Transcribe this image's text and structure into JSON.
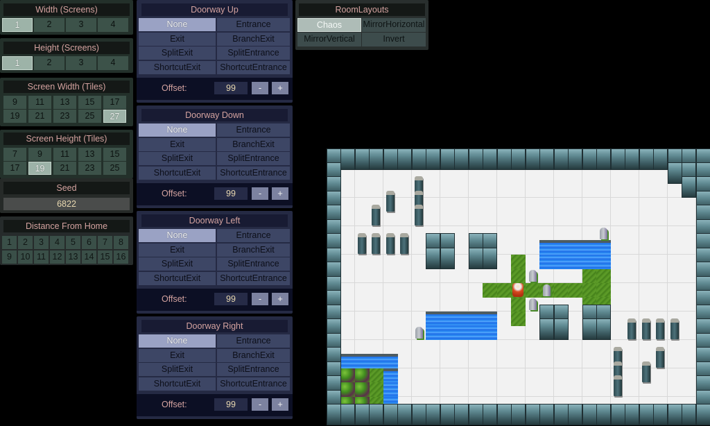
{
  "width_screens": {
    "title": "Width (Screens)",
    "options": [
      "1",
      "2",
      "3",
      "4"
    ],
    "selected": "1"
  },
  "height_screens": {
    "title": "Height (Screens)",
    "options": [
      "1",
      "2",
      "3",
      "4"
    ],
    "selected": "1"
  },
  "screen_width_tiles": {
    "title": "Screen Width (Tiles)",
    "options": [
      "9",
      "11",
      "13",
      "15",
      "17",
      "19",
      "21",
      "23",
      "25",
      "27"
    ],
    "selected": "27"
  },
  "screen_height_tiles": {
    "title": "Screen Height (Tiles)",
    "options": [
      "7",
      "9",
      "11",
      "13",
      "15",
      "17",
      "19",
      "21",
      "23",
      "25"
    ],
    "selected": "19"
  },
  "seed": {
    "title": "Seed",
    "value": "6822"
  },
  "distance_from_home": {
    "title": "Distance From Home",
    "options": [
      "1",
      "2",
      "3",
      "4",
      "5",
      "6",
      "7",
      "8",
      "9",
      "10",
      "11",
      "12",
      "13",
      "14",
      "15",
      "16"
    ],
    "selected": "1"
  },
  "doorway_options": [
    "None",
    "Entrance",
    "Exit",
    "BranchExit",
    "SplitExit",
    "SplitEntrance",
    "ShortcutExit",
    "ShortcutEntrance"
  ],
  "doorways": [
    {
      "title": "Doorway Up",
      "selected": "None",
      "offset_label": "Offset:",
      "offset": "99",
      "minus": "-",
      "plus": "+"
    },
    {
      "title": "Doorway Down",
      "selected": "None",
      "offset_label": "Offset:",
      "offset": "99",
      "minus": "-",
      "plus": "+"
    },
    {
      "title": "Doorway Left",
      "selected": "None",
      "offset_label": "Offset:",
      "offset": "99",
      "minus": "-",
      "plus": "+"
    },
    {
      "title": "Doorway Right",
      "selected": "None",
      "offset_label": "Offset:",
      "offset": "99",
      "minus": "-",
      "plus": "+"
    }
  ],
  "room_layouts": {
    "title": "RoomLayouts",
    "options": [
      "Chaos",
      "MirrorHorizontal",
      "MirrorVertical",
      "Invert"
    ],
    "selected": "Chaos"
  },
  "map": {
    "cols": 27,
    "rows": 19,
    "wall_extra": [
      [
        24,
        1
      ],
      [
        25,
        1
      ],
      [
        25,
        2
      ]
    ],
    "wall_blocks": [
      [
        7,
        6,
        2,
        2
      ],
      [
        10,
        6,
        2,
        2
      ],
      [
        15,
        11,
        2,
        2
      ],
      [
        18,
        11,
        2,
        2
      ]
    ],
    "water": [
      [
        15,
        6,
        5,
        2
      ],
      [
        7,
        11,
        5,
        2
      ],
      [
        1,
        14,
        4,
        1
      ],
      [
        4,
        15,
        1,
        3
      ]
    ],
    "grass": [
      [
        13,
        7,
        1,
        5
      ],
      [
        11,
        9,
        9,
        1
      ],
      [
        18,
        8,
        2,
        3
      ],
      [
        1,
        15,
        3,
        3
      ]
    ],
    "trees": [
      [
        1,
        15,
        2,
        3
      ]
    ],
    "pillars": [
      [
        6,
        2
      ],
      [
        6,
        3
      ],
      [
        6,
        4
      ],
      [
        4,
        3
      ],
      [
        3,
        4
      ],
      [
        2,
        6
      ],
      [
        3,
        6
      ],
      [
        4,
        6
      ],
      [
        5,
        6
      ],
      [
        21,
        12
      ],
      [
        22,
        12
      ],
      [
        23,
        12
      ],
      [
        24,
        12
      ],
      [
        20,
        14
      ],
      [
        20,
        15
      ],
      [
        20,
        16
      ],
      [
        22,
        15
      ],
      [
        23,
        14
      ]
    ],
    "stubs": [
      [
        14,
        8
      ],
      [
        15,
        9
      ],
      [
        14,
        10
      ],
      [
        19,
        5
      ],
      [
        6,
        12
      ]
    ],
    "hero": [
      13,
      9
    ]
  }
}
